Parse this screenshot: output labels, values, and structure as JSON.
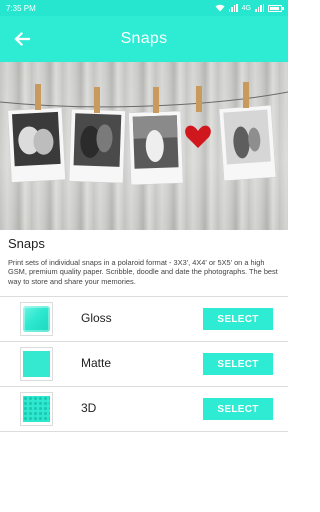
{
  "status_bar": {
    "time": "7:35 PM",
    "network_label": "4G"
  },
  "app_bar": {
    "title": "Snaps",
    "back_icon": "arrow-left-icon"
  },
  "product": {
    "title": "Snaps",
    "description": "Print sets of individual snaps in a polaroid format - 3X3', 4X4' or 5X5' on a high GSM, premium quality paper. Scribble, doodle and date the photographs. The best way to store and share your memories."
  },
  "options": [
    {
      "label": "Gloss",
      "button": "SELECT",
      "swatch": "gloss"
    },
    {
      "label": "Matte",
      "button": "SELECT",
      "swatch": "matte"
    },
    {
      "label": "3D",
      "button": "SELECT",
      "swatch": "textured"
    }
  ],
  "colors": {
    "accent": "#2eecd4",
    "status_bar": "#27e6cf"
  }
}
